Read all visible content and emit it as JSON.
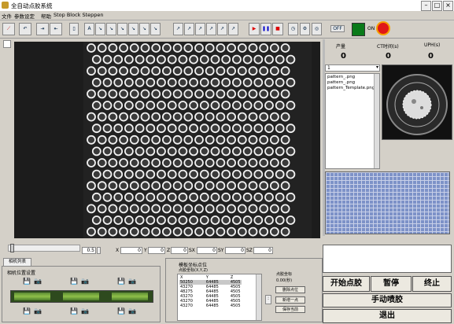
{
  "window": {
    "title": "全自动点胶系统"
  },
  "menu": [
    "文件",
    "参数设定",
    "帮助",
    "Stop Block Steppen"
  ],
  "counters": [
    {
      "label": "产量",
      "value": "0"
    },
    {
      "label": "CT时间(s)",
      "value": "0"
    },
    {
      "label": "UPH(s)",
      "value": "0"
    }
  ],
  "right": {
    "select_value": "1",
    "files": [
      "pattern_.png",
      "pattern_.png",
      "pattern_Template.png"
    ]
  },
  "nav": {
    "zoom": "0.5",
    "x": "0",
    "y": "0",
    "z": "0",
    "sx": "0",
    "sy": "0",
    "sz": "0",
    "labels": [
      "X",
      "Y",
      "Z",
      "SX",
      "SY",
      "SZ"
    ]
  },
  "bottom_left": {
    "tab": "相机列表",
    "group": "相机位置设置"
  },
  "point_panel": {
    "title": "模板坐标点位",
    "subtitle": "点胶坐标(X,Y,Z)",
    "headers": [
      "X",
      "Y",
      "Z"
    ],
    "rows": [
      [
        "50250",
        "64485",
        "4505"
      ],
      [
        "43270",
        "64485",
        "4505"
      ],
      [
        "48275",
        "64485",
        "4505"
      ],
      [
        "43270",
        "64485",
        "4505"
      ],
      [
        "43270",
        "64485",
        "4505"
      ],
      [
        "43270",
        "64485",
        "4505"
      ]
    ],
    "side_label": "点胶坐标",
    "time_label": "0.00(秒)",
    "buttons": [
      "删除点位",
      "新增一点",
      "保存当前"
    ]
  },
  "actions": {
    "start": "开始点胶",
    "pause": "暂停",
    "stop": "终止",
    "manual": "手动喷胶",
    "exit": "退出"
  },
  "status": {
    "label": "OFF"
  }
}
